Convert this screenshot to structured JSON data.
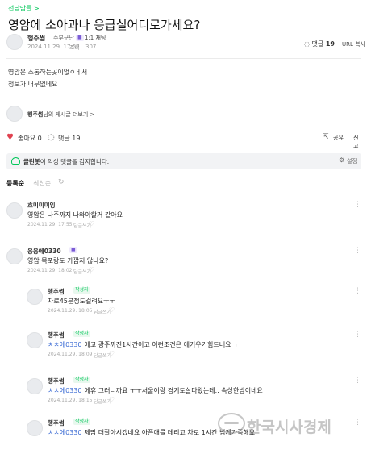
{
  "breadcrumb": "전남맘들 >",
  "post": {
    "title": "영암에 소아과나 응급실어디로가세요?",
    "author": {
      "name": "행주썸",
      "grade": "주부구단",
      "chat_label": "1:1 채팅",
      "date": "2024.11.29. 17:52",
      "views_label": "조회",
      "views": "307"
    },
    "comment_count_label": "댓글",
    "comment_count": "19",
    "url_copy": "URL 복사",
    "body": [
      "영암은 소통하는곳이없ㅇㅓ서",
      "정보가 너무없네요"
    ]
  },
  "more_posts": {
    "name": "행주썸",
    "suffix": "님의 게시글 더보기",
    "chevron": ">"
  },
  "actions": {
    "heart_icon": "♥",
    "like": "좋아요 0",
    "comment_icon": "◌",
    "comment": "댓글 19",
    "share_icon": "⇱",
    "share": "공유",
    "report": "신고"
  },
  "cleanbot": {
    "name": "클린봇",
    "message": "이 악성 댓글을 감지합니다.",
    "gear_icon": "⚙",
    "settings": "설정"
  },
  "sort": {
    "active": "등록순",
    "inactive": "최신순",
    "refresh_icon": "↻"
  },
  "comments": [
    {
      "nick": "흐미미미잉",
      "text": "영암은 나주까지 나와야할거 같아요",
      "date": "2024.11.29. 17:55",
      "reply": "답글쓰기"
    },
    {
      "nick": "응응에0330",
      "text": "영암 목포랑도 가깝지 않나요?",
      "date": "2024.11.29. 18:02",
      "reply": "답글쓰기"
    },
    {
      "nick": "행주썸",
      "badge": "작성자",
      "text": "차로45분정도걸려요ㅜㅜ",
      "date": "2024.11.29. 18:05",
      "reply": "답글쓰기"
    },
    {
      "nick": "행주썸",
      "badge": "작성자",
      "mention": "ㅊㅊ에0330",
      "text": "에고 광주까진1시간이고 이런조건은 애키우기힘드네요 ㅜ",
      "date": "2024.11.29. 18:09",
      "reply": "답글쓰기"
    },
    {
      "nick": "행주썸",
      "badge": "작성자",
      "mention": "ㅊㅊ에0330",
      "text": "에휴 그러니까요 ㅜㅜ서울이랑 경기도살다왔는데.. 속상한방이네요",
      "date": "2024.11.29. 18:15",
      "reply": "답글쓰기"
    },
    {
      "nick": "행주썸",
      "badge": "작성자",
      "mention": "ㅊㅊ에0330",
      "text": "제맘 더잘아시겠네요 아픈애를 데리고 차로 1시간 넘게가죽해요",
      "date": "",
      "reply": ""
    }
  ],
  "like_icon": "♡",
  "menu_icon": "⋮",
  "watermark": "한국시사경제"
}
